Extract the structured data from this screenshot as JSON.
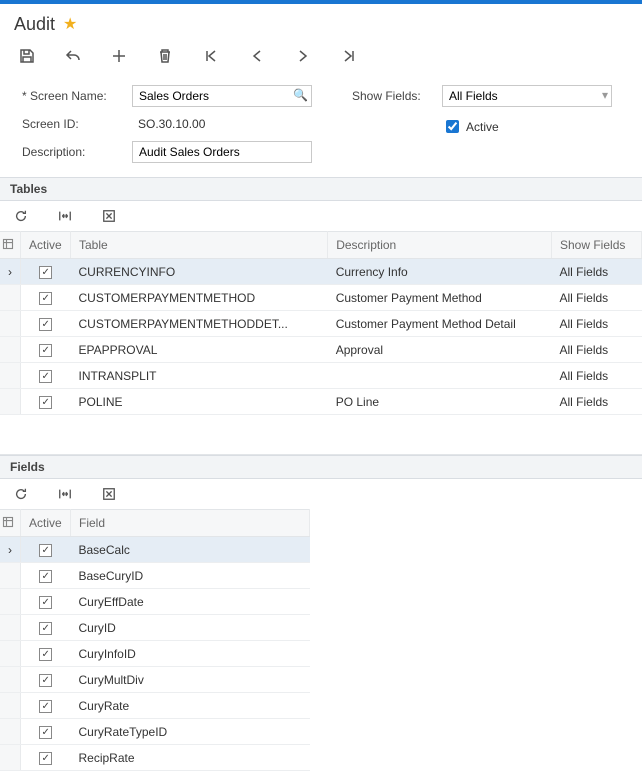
{
  "page": {
    "title": "Audit"
  },
  "form": {
    "screen_name_label": "Screen Name:",
    "screen_name_value": "Sales Orders",
    "screen_id_label": "Screen ID:",
    "screen_id_value": "SO.30.10.00",
    "description_label": "Description:",
    "description_value": "Audit Sales Orders",
    "show_fields_label": "Show Fields:",
    "show_fields_value": "All Fields",
    "active_label": "Active",
    "active_checked": true
  },
  "tables": {
    "title": "Tables",
    "columns": {
      "active": "Active",
      "table": "Table",
      "description": "Description",
      "show_fields": "Show Fields"
    },
    "rows": [
      {
        "active": true,
        "table": "CURRENCYINFO",
        "description": "Currency Info",
        "show_fields": "All Fields",
        "selected": true
      },
      {
        "active": true,
        "table": "CUSTOMERPAYMENTMETHOD",
        "description": "Customer Payment Method",
        "show_fields": "All Fields"
      },
      {
        "active": true,
        "table": "CUSTOMERPAYMENTMETHODDET...",
        "description": "Customer Payment Method Detail",
        "show_fields": "All Fields"
      },
      {
        "active": true,
        "table": "EPAPPROVAL",
        "description": "Approval",
        "show_fields": "All Fields"
      },
      {
        "active": true,
        "table": "INTRANSPLIT",
        "description": "",
        "show_fields": "All Fields"
      },
      {
        "active": true,
        "table": "POLINE",
        "description": "PO Line",
        "show_fields": "All Fields"
      }
    ]
  },
  "fields": {
    "title": "Fields",
    "columns": {
      "active": "Active",
      "field": "Field"
    },
    "rows": [
      {
        "active": true,
        "field": "BaseCalc",
        "selected": true
      },
      {
        "active": true,
        "field": "BaseCuryID"
      },
      {
        "active": true,
        "field": "CuryEffDate"
      },
      {
        "active": true,
        "field": "CuryID"
      },
      {
        "active": true,
        "field": "CuryInfoID"
      },
      {
        "active": true,
        "field": "CuryMultDiv"
      },
      {
        "active": true,
        "field": "CuryRate"
      },
      {
        "active": true,
        "field": "CuryRateTypeID"
      },
      {
        "active": true,
        "field": "RecipRate"
      }
    ]
  }
}
